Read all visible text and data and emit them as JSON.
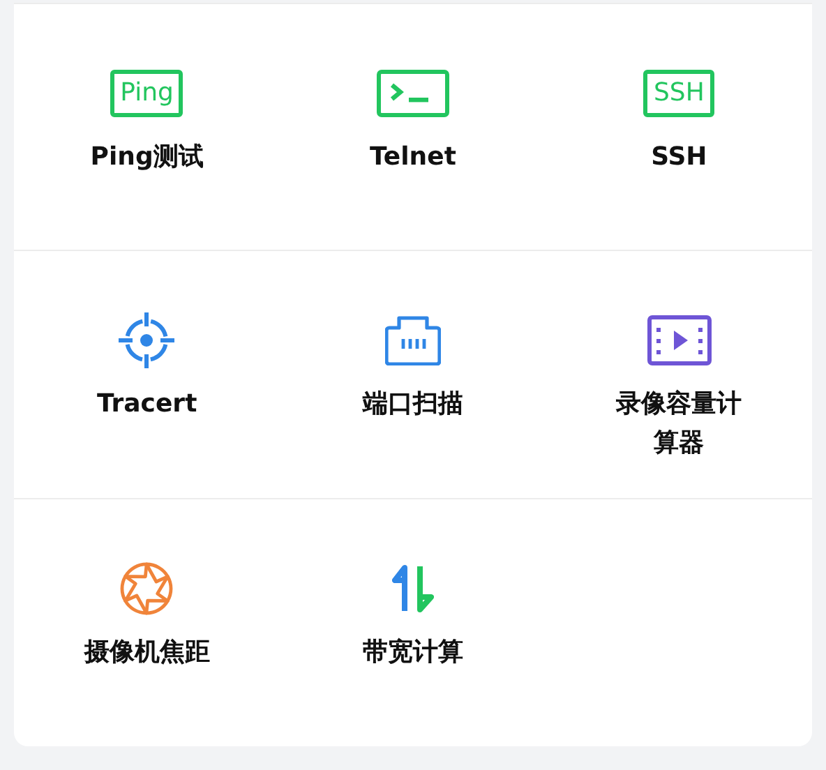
{
  "tools": [
    [
      {
        "kind": "text-box",
        "icon_text": "Ping",
        "color": "#22c55e",
        "label": "Ping测试"
      },
      {
        "kind": "terminal",
        "color": "#22c55e",
        "label": "Telnet"
      },
      {
        "kind": "text-box",
        "icon_text": "SSH",
        "color": "#22c55e",
        "label": "SSH"
      }
    ],
    [
      {
        "kind": "target",
        "color": "#2f86e6",
        "label": "Tracert"
      },
      {
        "kind": "port",
        "color": "#2f86e6",
        "label": "端口扫描"
      },
      {
        "kind": "video",
        "color": "#6e55d6",
        "label": "录像容量计算器"
      }
    ],
    [
      {
        "kind": "aperture",
        "color": "#f0843a",
        "label": "摄像机焦距"
      },
      {
        "kind": "updown",
        "color": "#2f86e6",
        "label": "带宽计算"
      }
    ]
  ]
}
